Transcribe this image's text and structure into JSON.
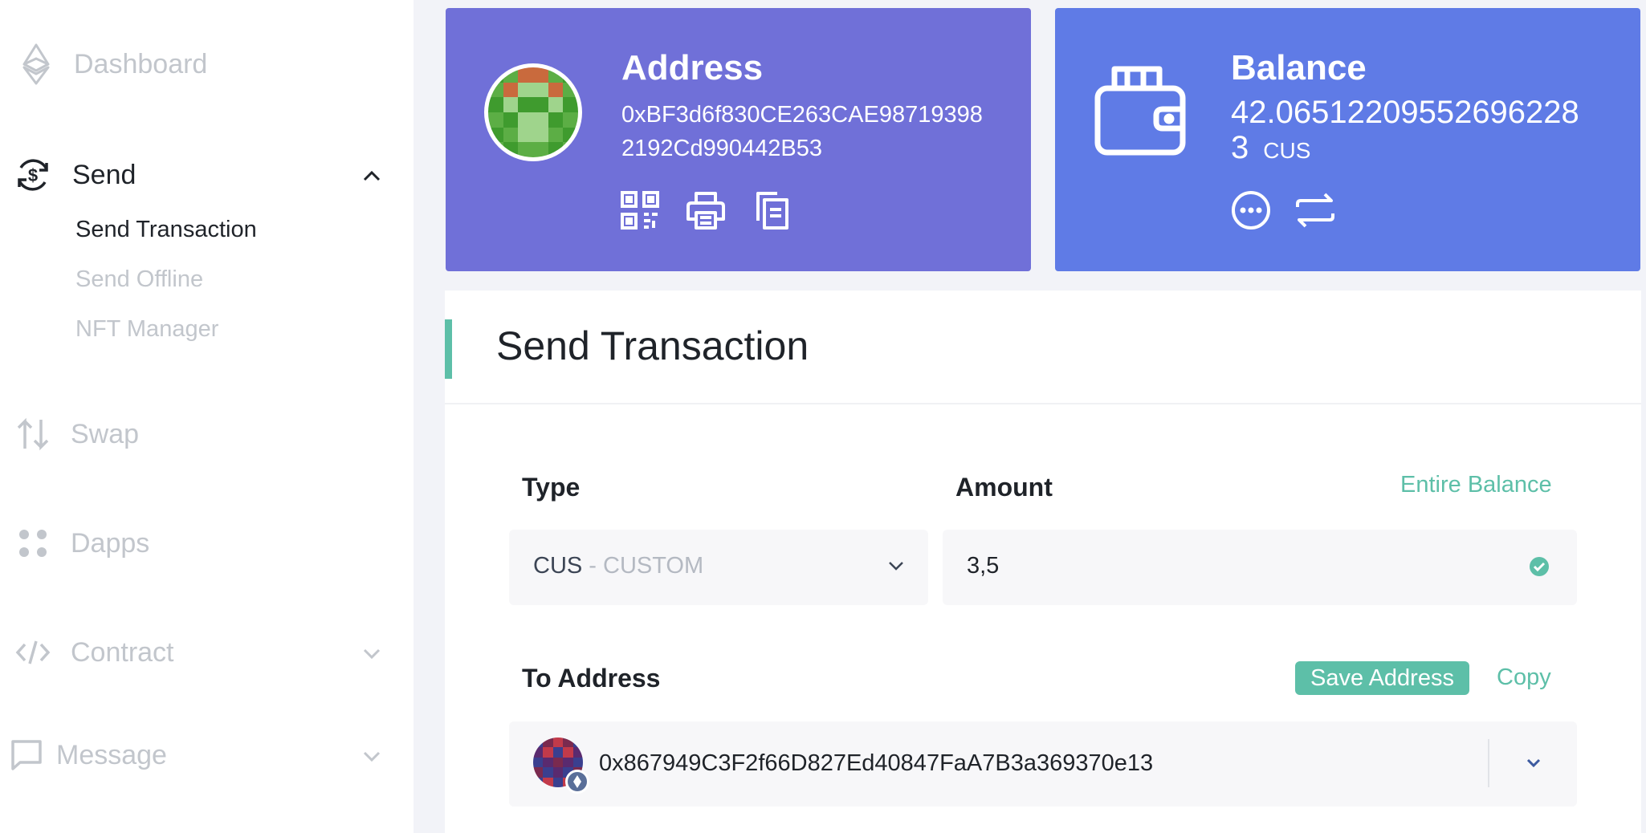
{
  "sidebar": {
    "dashboard": "Dashboard",
    "send": "Send",
    "send_items": [
      "Send Transaction",
      "Send Offline",
      "NFT Manager"
    ],
    "swap": "Swap",
    "dapps": "Dapps",
    "contract": "Contract",
    "message": "Message"
  },
  "address_card": {
    "title": "Address",
    "address_line1": "0xBF3d6f830CE263CAE98719398",
    "address_line2": "2192Cd990442B53",
    "icons": [
      "qr-code-icon",
      "print-icon",
      "copy-icon"
    ]
  },
  "balance_card": {
    "title": "Balance",
    "amount_line1": "42.06512209552696228",
    "amount_line2": "3",
    "unit": "CUS",
    "icons": [
      "more-icon",
      "swap-arrows-icon"
    ]
  },
  "send_panel": {
    "title": "Send Transaction",
    "type_label": "Type",
    "type_symbol": "CUS",
    "type_separator": " - ",
    "type_name": "CUSTOM",
    "amount_label": "Amount",
    "entire_balance": "Entire Balance",
    "amount_value": "3,5",
    "to_label": "To Address",
    "save_address": "Save Address",
    "copy": "Copy",
    "to_address": "0x867949C3F2f66D827Ed40847FaA7B3a369370e13"
  },
  "colors": {
    "accent_green": "#5dbfa8",
    "address_card": "#7070d8",
    "balance_card": "#5f7be6"
  }
}
